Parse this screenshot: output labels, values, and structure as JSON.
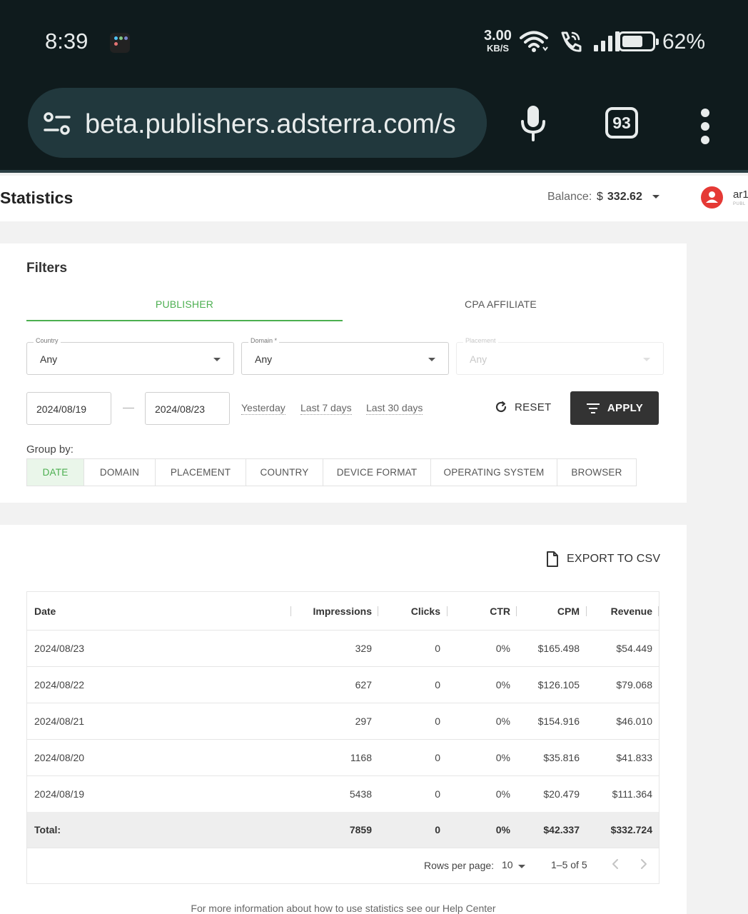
{
  "status_bar": {
    "time": "8:39",
    "net_speed": "3.00",
    "net_speed_unit": "KB/S",
    "battery": "62%",
    "icons": [
      "app-icon",
      "wifi-icon",
      "wifi-call-icon",
      "signal-icon",
      "battery-icon"
    ]
  },
  "browser": {
    "url": "beta.publishers.adsterra.com/s",
    "tab_count": "93"
  },
  "header": {
    "title": "Statistics",
    "balance_label": "Balance:",
    "balance_currency": "$",
    "balance_value": "332.62",
    "user_name": "ar1",
    "user_role": "PUBL"
  },
  "filters": {
    "title": "Filters",
    "tabs": [
      {
        "label": "PUBLISHER",
        "active": true
      },
      {
        "label": "CPA AFFILIATE",
        "active": false
      }
    ],
    "country": {
      "label": "Country",
      "value": "Any"
    },
    "domain": {
      "label": "Domain *",
      "value": "Any"
    },
    "placement": {
      "label": "Placement",
      "value": "Any",
      "disabled": true
    },
    "date_from": "2024/08/19",
    "date_to": "2024/08/23",
    "quick_ranges": [
      "Yesterday",
      "Last 7 days",
      "Last 30 days"
    ],
    "reset_label": "RESET",
    "apply_label": "APPLY",
    "group_by_label": "Group by:",
    "group_by": [
      {
        "label": "DATE",
        "active": true
      },
      {
        "label": "DOMAIN"
      },
      {
        "label": "PLACEMENT"
      },
      {
        "label": "COUNTRY"
      },
      {
        "label": "DEVICE FORMAT"
      },
      {
        "label": "OPERATING SYSTEM"
      },
      {
        "label": "BROWSER"
      }
    ]
  },
  "stats": {
    "export_label": "EXPORT TO CSV",
    "columns": [
      "Date",
      "Impressions",
      "Clicks",
      "CTR",
      "CPM",
      "Revenue"
    ],
    "rows": [
      [
        "2024/08/23",
        "329",
        "0",
        "0%",
        "$165.498",
        "$54.449"
      ],
      [
        "2024/08/22",
        "627",
        "0",
        "0%",
        "$126.105",
        "$79.068"
      ],
      [
        "2024/08/21",
        "297",
        "0",
        "0%",
        "$154.916",
        "$46.010"
      ],
      [
        "2024/08/20",
        "1168",
        "0",
        "0%",
        "$35.816",
        "$41.833"
      ],
      [
        "2024/08/19",
        "5438",
        "0",
        "0%",
        "$20.479",
        "$111.364"
      ]
    ],
    "total": [
      "Total:",
      "7859",
      "0",
      "0%",
      "$42.337",
      "$332.724"
    ],
    "rows_per_page_label": "Rows per page:",
    "rows_per_page": "10",
    "range": "1–5 of 5"
  },
  "help_text": "For more information about how to use statistics see our Help Center"
}
